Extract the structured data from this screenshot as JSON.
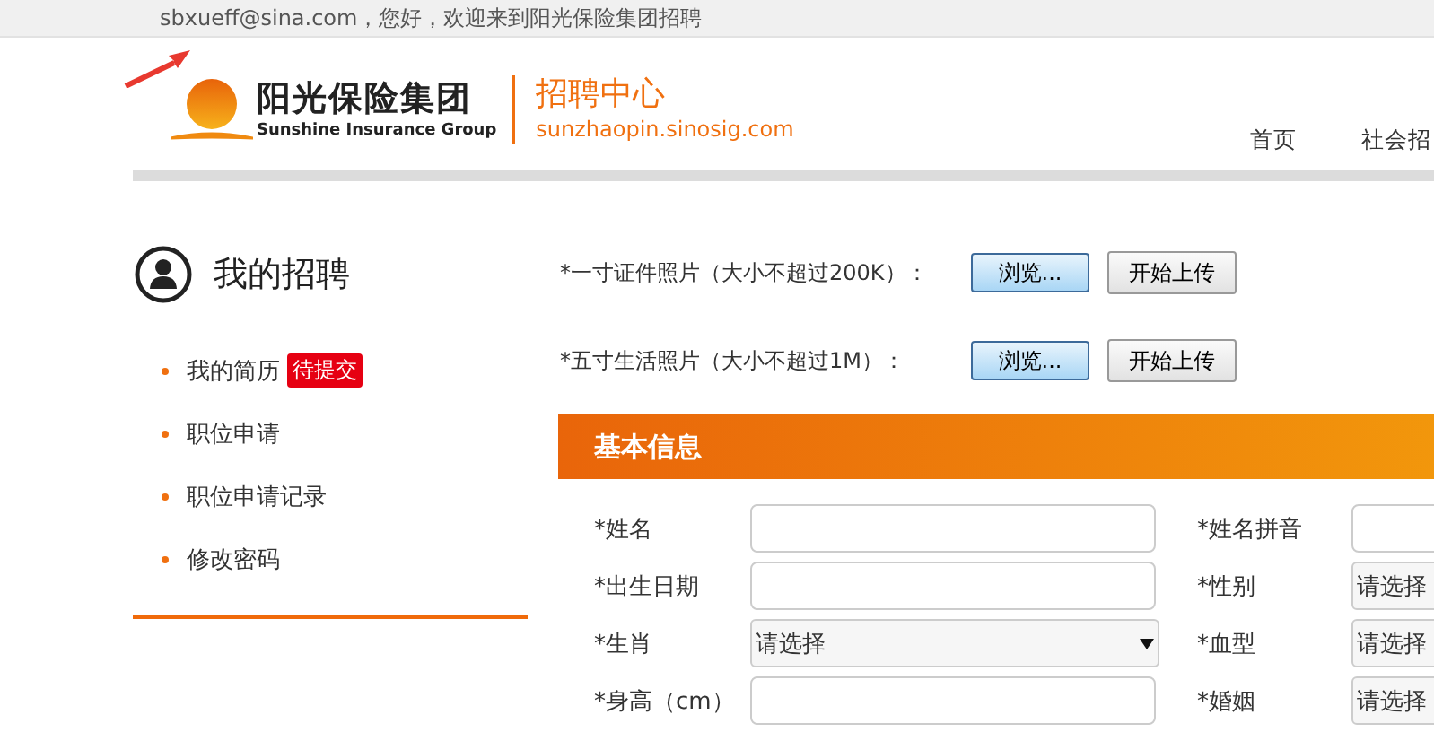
{
  "top_bar": {
    "greeting": "sbxueff@sina.com，您好，欢迎来到阳光保险集团招聘"
  },
  "header": {
    "logo_cn": "阳光保险集团",
    "logo_en": "Sunshine Insurance Group",
    "center_title": "招聘中心",
    "center_url": "sunzhaopin.sinosig.com",
    "nav": [
      {
        "label": "首页",
        "selected": false
      },
      {
        "label": "社会招",
        "selected": false
      }
    ]
  },
  "sidebar": {
    "title": "我的招聘",
    "items": [
      {
        "label": "我的简历",
        "badge": "待提交"
      },
      {
        "label": "职位申请"
      },
      {
        "label": "职位申请记录"
      },
      {
        "label": "修改密码"
      }
    ]
  },
  "uploads": [
    {
      "label": "*一寸证件照片（大小不超过200K）：",
      "browse": "浏览...",
      "upload": "开始上传"
    },
    {
      "label": "*五寸生活照片（大小不超过1M）：",
      "browse": "浏览...",
      "upload": "开始上传"
    }
  ],
  "section": {
    "title": "基本信息"
  },
  "fields": [
    {
      "label": "*姓名",
      "kind": "input"
    },
    {
      "label": "*姓名拼音",
      "kind": "input"
    },
    {
      "label": "*出生日期",
      "kind": "input"
    },
    {
      "label": "*性别",
      "kind": "select",
      "value": "请选择"
    },
    {
      "label": "*生肖",
      "kind": "select",
      "value": "请选择"
    },
    {
      "label": "*血型",
      "kind": "select",
      "value": "请选择"
    },
    {
      "label": "*身高（cm）",
      "kind": "input"
    },
    {
      "label": "*婚姻",
      "kind": "select",
      "value": "请选择"
    }
  ]
}
